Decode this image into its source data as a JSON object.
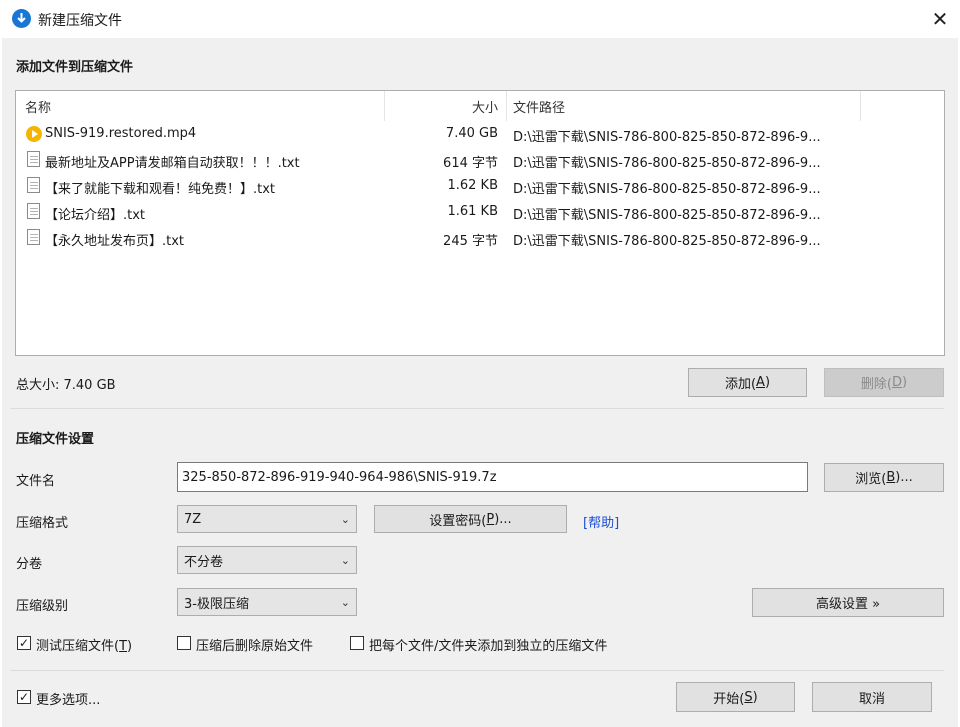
{
  "window": {
    "title": "新建压缩文件",
    "close_glyph": "✕"
  },
  "add_section": {
    "title": "添加文件到压缩文件"
  },
  "file_list": {
    "columns": {
      "name": "名称",
      "size": "大小",
      "path": "文件路径"
    },
    "rows": [
      {
        "icon": "video-file-icon",
        "name": "SNIS-919.restored.mp4",
        "size": "7.40 GB",
        "path": "D:\\迅雷下载\\SNIS-786-800-825-850-872-896-9..."
      },
      {
        "icon": "text-file-icon",
        "name": "最新地址及APP请发邮箱自动获取！！！.txt",
        "size": "614 字节",
        "path": "D:\\迅雷下载\\SNIS-786-800-825-850-872-896-9..."
      },
      {
        "icon": "text-file-icon",
        "name": "【来了就能下载和观看！纯免费！】.txt",
        "size": "1.62 KB",
        "path": "D:\\迅雷下载\\SNIS-786-800-825-850-872-896-9..."
      },
      {
        "icon": "text-file-icon",
        "name": "【论坛介绍】.txt",
        "size": "1.61 KB",
        "path": "D:\\迅雷下载\\SNIS-786-800-825-850-872-896-9..."
      },
      {
        "icon": "text-file-icon",
        "name": "【永久地址发布页】.txt",
        "size": "245 字节",
        "path": "D:\\迅雷下载\\SNIS-786-800-825-850-872-896-9..."
      }
    ]
  },
  "total_size": "总大小: 7.40 GB",
  "buttons": {
    "add": {
      "label": "添加(",
      "key": "A",
      "suffix": ")"
    },
    "delete": {
      "label": "删除(",
      "key": "D",
      "suffix": ")"
    },
    "browse": {
      "label": "浏览(",
      "key": "B",
      "suffix": ")..."
    },
    "password": {
      "label": "设置密码(",
      "key": "P",
      "suffix": ")..."
    },
    "advanced": "高级设置 »",
    "start": {
      "label": "开始(",
      "key": "S",
      "suffix": ")"
    },
    "cancel": "取消"
  },
  "settings": {
    "title": "压缩文件设置",
    "filename_label": "文件名",
    "filename_value": "325-850-872-896-919-940-964-986\\SNIS-919.7z",
    "format_label": "压缩格式",
    "format_value": "7Z",
    "help_link": "[帮助]",
    "volume_label": "分卷",
    "volume_value": "不分卷",
    "level_label": "压缩级别",
    "level_value": "3-极限压缩"
  },
  "options": {
    "test": {
      "label": "测试压缩文件(",
      "key": "T",
      "suffix": ")",
      "checked": true
    },
    "delete_after": {
      "label": "压缩后删除原始文件",
      "checked": false
    },
    "separate": {
      "label": "把每个文件/文件夹添加到独立的压缩文件",
      "checked": false
    },
    "more": {
      "label": "更多选项...",
      "checked": true
    }
  },
  "check_glyph": "✓"
}
